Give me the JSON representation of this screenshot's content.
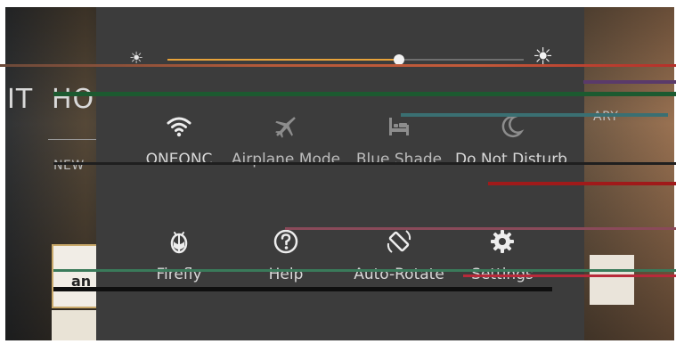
{
  "background": {
    "home_title": "HO",
    "left_fragment": "IT",
    "sub_left": "NEW",
    "sub_right": "ARY",
    "card_label": "an"
  },
  "brightness": {
    "level": 0.65,
    "low_icon": "brightness-low-icon",
    "high_icon": "brightness-high-icon",
    "accent": "#e8a33a"
  },
  "tiles": [
    {
      "id": "wifi",
      "label": "ONEONC",
      "icon": "wifi-icon",
      "active": true
    },
    {
      "id": "airplane",
      "label": "Airplane Mode",
      "icon": "airplane-icon",
      "active": false
    },
    {
      "id": "blueshade",
      "label": "Blue Shade",
      "icon": "bed-icon",
      "active": false
    },
    {
      "id": "dnd",
      "label": "Do Not Disturb",
      "icon": "moon-icon",
      "active": false
    },
    {
      "id": "firefly",
      "label": "Firefly",
      "icon": "firefly-icon",
      "active": true
    },
    {
      "id": "help",
      "label": "Help",
      "icon": "help-icon",
      "active": true
    },
    {
      "id": "autorotate",
      "label": "Auto-Rotate",
      "icon": "rotate-icon",
      "active": true
    },
    {
      "id": "settings",
      "label": "Settings",
      "icon": "gear-icon",
      "active": true
    }
  ]
}
